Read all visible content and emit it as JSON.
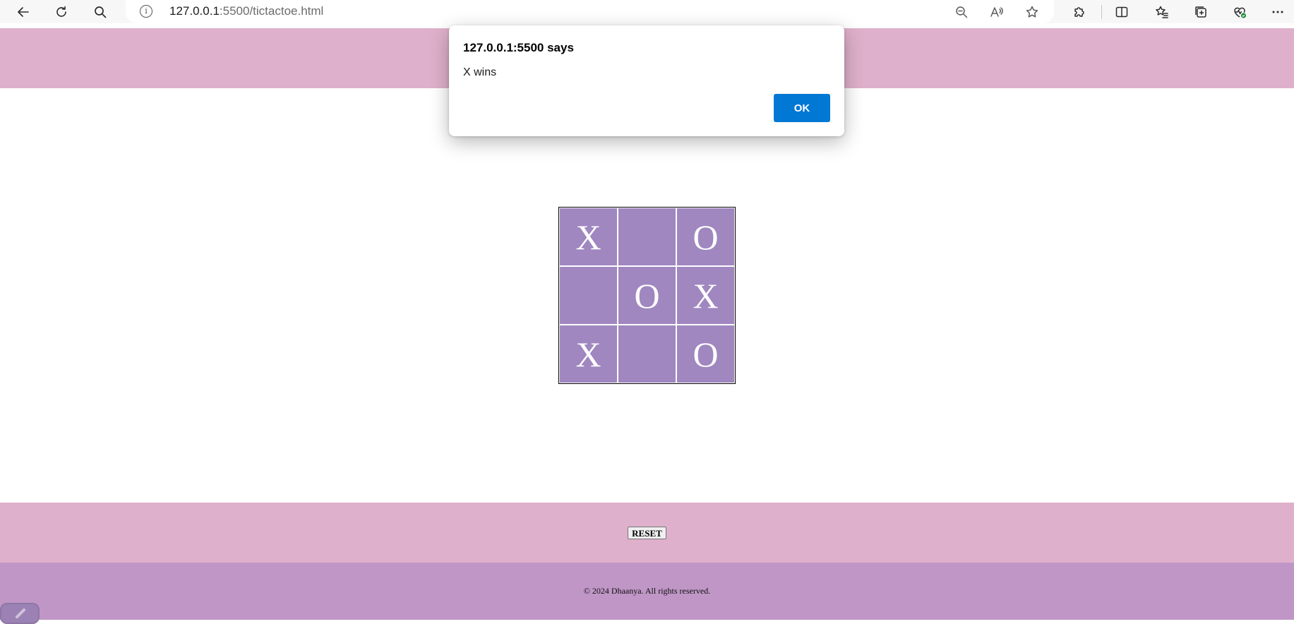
{
  "browser": {
    "url_host": "127.0.0.1",
    "url_rest": ":5500/tictactoe.html",
    "icons": [
      "back-icon",
      "refresh-icon",
      "search-icon",
      "site-info-icon",
      "zoom-out-icon",
      "read-aloud-icon",
      "favorite-star-icon",
      "extensions-icon",
      "split-screen-icon",
      "favorites-icon",
      "collections-icon",
      "browser-essentials-icon",
      "more-icon"
    ]
  },
  "dialog": {
    "title": "127.0.0.1:5500 says",
    "message": "X wins",
    "ok_label": "OK"
  },
  "board": {
    "cells": [
      "X",
      "",
      "O",
      "",
      "O",
      "X",
      "X",
      "",
      "O"
    ]
  },
  "controls": {
    "reset_label": "RESET"
  },
  "footer": {
    "copyright": "© 2024 Dhaanya. All rights reserved."
  },
  "colors": {
    "header_band": "#dfb0cb",
    "cell": "#a087c0",
    "footer": "#bf96c6",
    "dialog_button": "#0078d4"
  }
}
